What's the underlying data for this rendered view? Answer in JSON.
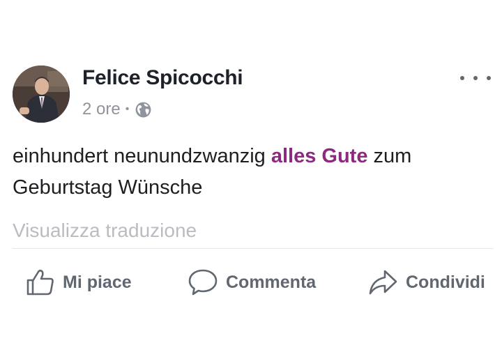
{
  "post": {
    "author": "Felice Spicocchi",
    "time": "2 ore",
    "separator": "•",
    "visibility_icon": "globe-icon",
    "text_before": "einhundert neunundzwanzig ",
    "text_highlight": "alles Gute",
    "text_after": " zum Geburtstag Wünsche",
    "translate_label": "Visualizza traduzione",
    "highlight_color": "#8b2a7f"
  },
  "actions": {
    "like_label": "Mi piace",
    "comment_label": "Commenta",
    "share_label": "Condividi",
    "like_icon": "thumbs-up-icon",
    "comment_icon": "comment-bubble-icon",
    "share_icon": "share-arrow-icon"
  },
  "menu": {
    "more_icon": "more-options-icon"
  }
}
